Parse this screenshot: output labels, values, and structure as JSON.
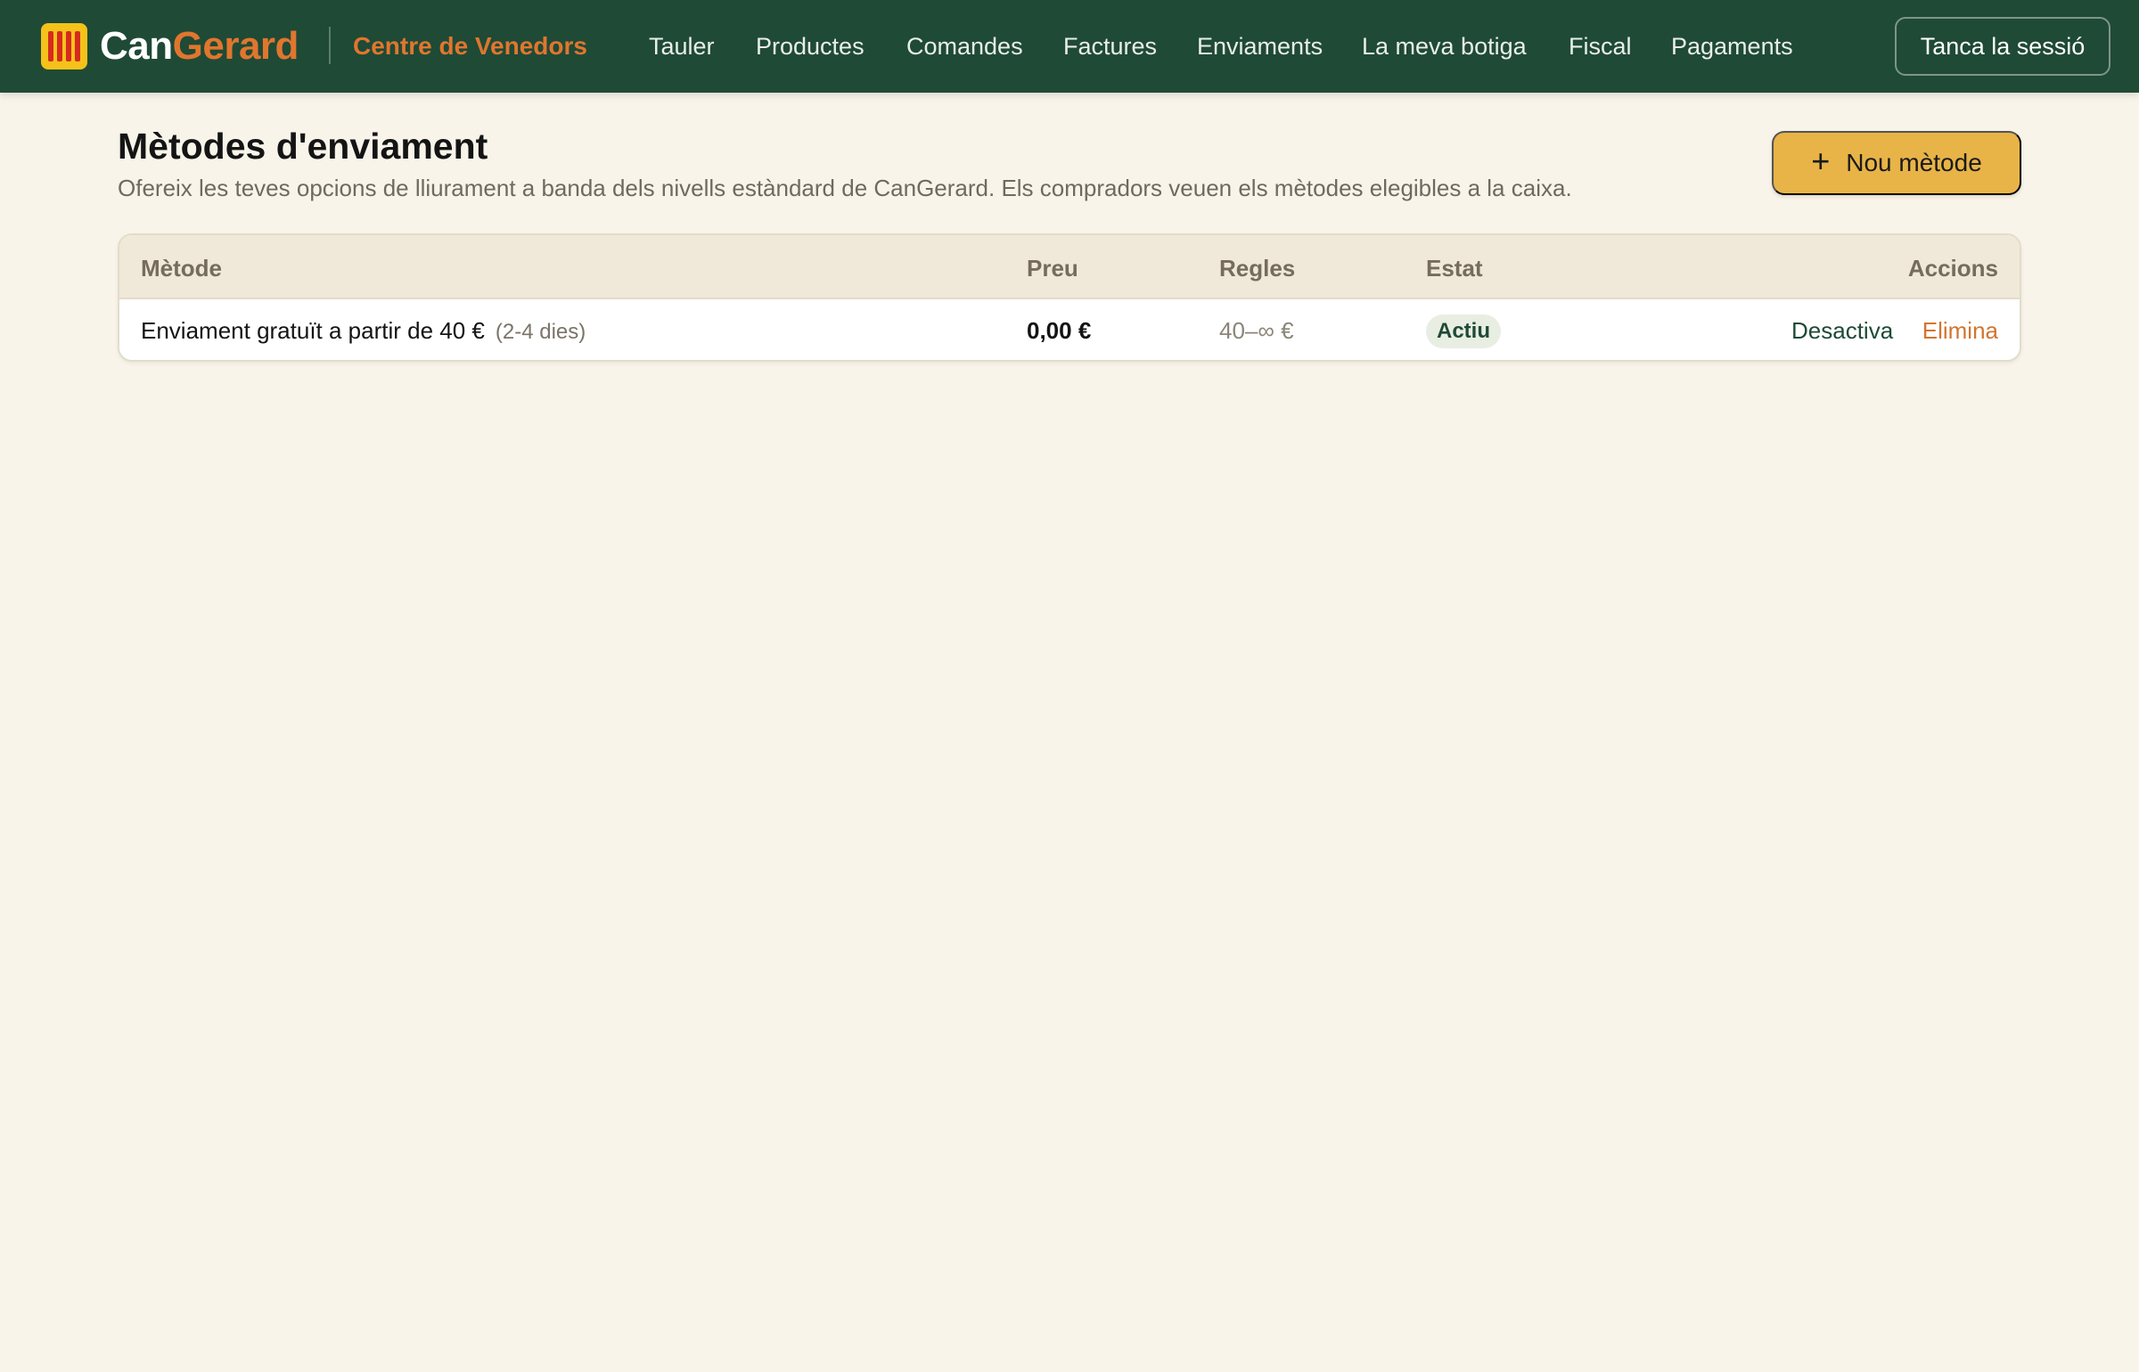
{
  "brand": {
    "name_part1": "Can",
    "name_part2": "Gerard",
    "subtitle": "Centre de Venedors"
  },
  "nav": {
    "items": [
      {
        "label": "Tauler"
      },
      {
        "label": "Productes"
      },
      {
        "label": "Comandes"
      },
      {
        "label": "Factures"
      },
      {
        "label": "Enviaments"
      },
      {
        "label": "La meva botiga"
      },
      {
        "label": "Fiscal"
      },
      {
        "label": "Pagaments"
      }
    ],
    "logout_label": "Tanca la sessió"
  },
  "page": {
    "title": "Mètodes d'enviament",
    "description": "Ofereix les teves opcions de lliurament a banda dels nivells estàndard de CanGerard. Els compradors veuen els mètodes elegibles a la caixa.",
    "new_button_icon": "plus-icon",
    "new_button_label": "Nou mètode"
  },
  "table": {
    "headers": {
      "method": "Mètode",
      "price": "Preu",
      "rules": "Regles",
      "status": "Estat",
      "actions": "Accions"
    },
    "rows": [
      {
        "method": "Enviament gratuït a partir de 40 €",
        "days": "(2-4 dies)",
        "price": "0,00 €",
        "rules": "40–∞ €",
        "status": "Actiu",
        "action_toggle": "Desactiva",
        "action_delete": "Elimina"
      }
    ]
  },
  "colors": {
    "topbar": "#1f4a36",
    "accent_orange": "#e0762e",
    "button_yellow": "#e8b447",
    "page_bg": "#f8f4ea"
  }
}
